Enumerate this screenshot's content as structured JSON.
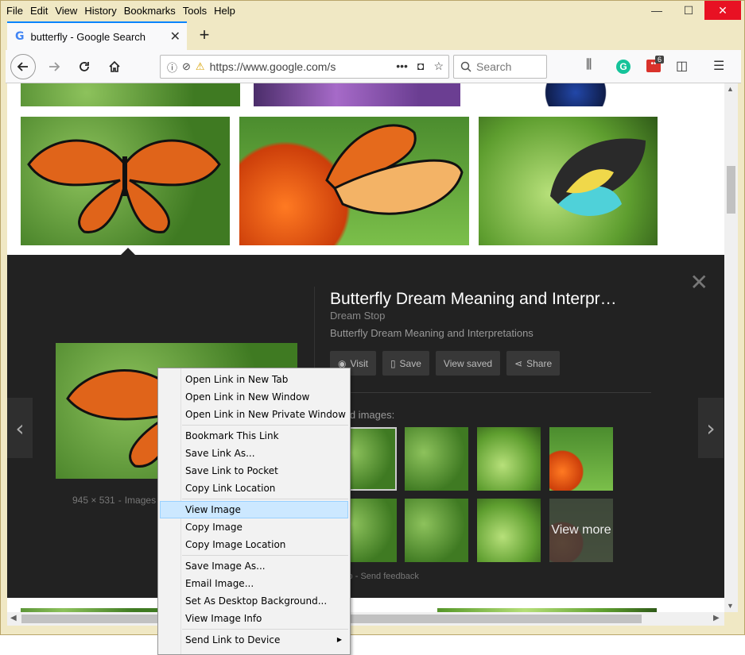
{
  "menubar": [
    "File",
    "Edit",
    "View",
    "History",
    "Bookmarks",
    "Tools",
    "Help"
  ],
  "window_controls": {
    "minimize": "—",
    "maximize": "☐",
    "close": "✕"
  },
  "tab": {
    "favicon": "G",
    "title": "butterfly - Google Search",
    "close": "✕",
    "new_tab": "+"
  },
  "nav": {
    "url": "https://www.google.com/s",
    "search_placeholder": "Search",
    "ext_badge": "6",
    "grammarly": "G"
  },
  "panel": {
    "title": "Butterfly Dream Meaning and Interpr…",
    "source": "Dream Stop",
    "description": "Butterfly Dream Meaning and Interpretations",
    "buttons": [
      "Visit",
      "Save",
      "View saved",
      "Share"
    ],
    "related_label": "ted images:",
    "image_meta": {
      "size": "945 × 531",
      "sep": "-",
      "label": "Images"
    },
    "view_more": "View more",
    "footer": "elp  -  Send feedback",
    "close": "✕",
    "prev": "‹",
    "next": "›"
  },
  "context_menu": {
    "groups": [
      [
        "Open Link in New Tab",
        "Open Link in New Window",
        "Open Link in New Private Window"
      ],
      [
        "Bookmark This Link",
        "Save Link As...",
        "Save Link to Pocket",
        "Copy Link Location"
      ],
      [
        "View Image",
        "Copy Image",
        "Copy Image Location"
      ],
      [
        "Save Image As...",
        "Email Image...",
        "Set As Desktop Background...",
        "View Image Info"
      ],
      [
        "Send Link to Device"
      ]
    ],
    "highlighted": "View Image"
  },
  "colors": {
    "accent": "#0a84ff",
    "panel_bg": "#222222",
    "menu_highlight": "#cce8ff",
    "close_red": "#e81123"
  }
}
